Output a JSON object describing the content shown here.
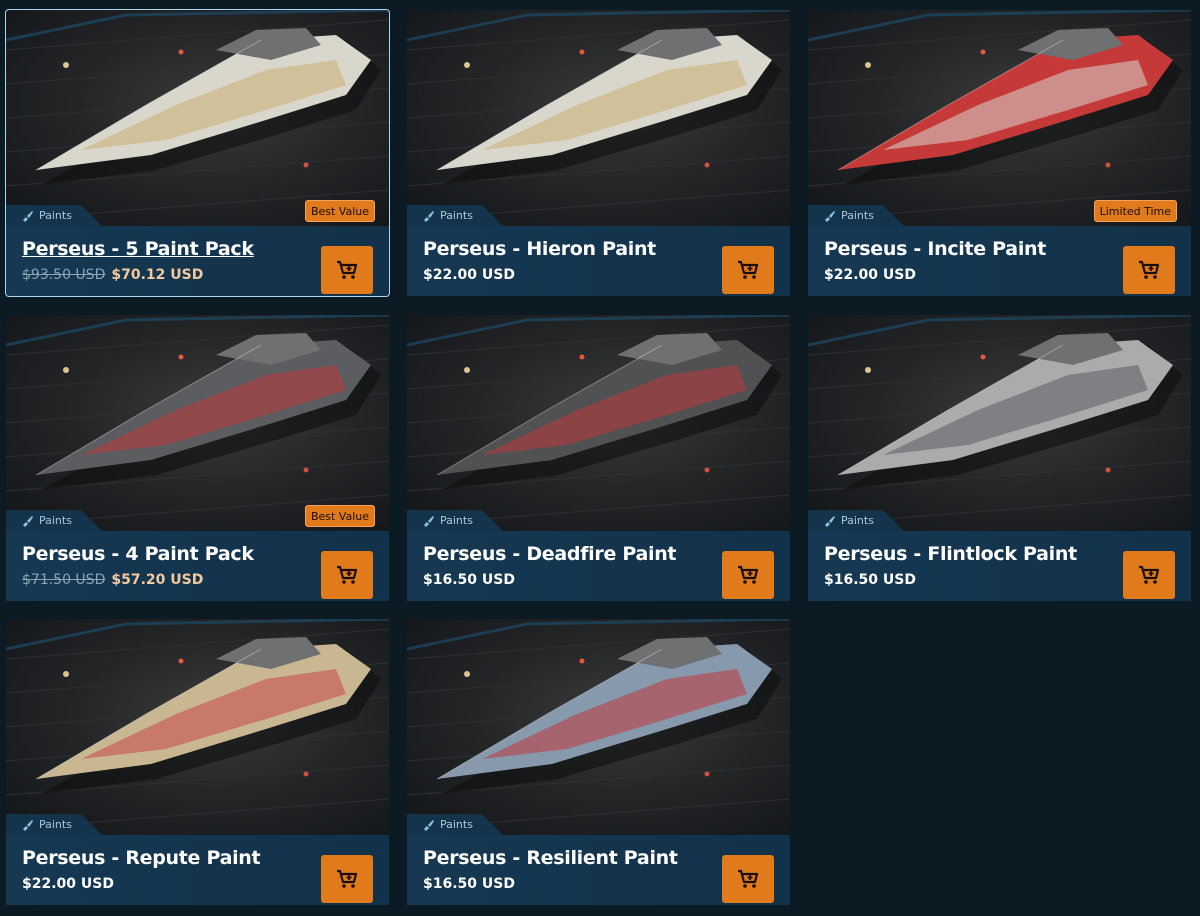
{
  "products": [
    {
      "category": "Paints",
      "title": "Perseus - 5 Paint Pack",
      "old_price": "$93.50 USD",
      "price": "$70.12 USD",
      "badge": "Best Value",
      "hull": "#d9d6cc",
      "accent": "#c9b071",
      "selected": true
    },
    {
      "category": "Paints",
      "title": "Perseus - Hieron Paint",
      "old_price": "",
      "price": "$22.00 USD",
      "badge": "",
      "hull": "#d9d6cc",
      "accent": "#c9b071"
    },
    {
      "category": "Paints",
      "title": "Perseus - Incite Paint",
      "old_price": "",
      "price": "$22.00 USD",
      "badge": "Limited Time",
      "hull": "#c53a38",
      "accent": "#d6d4d0"
    },
    {
      "category": "Paints",
      "title": "Perseus - 4 Paint Pack",
      "old_price": "$71.50 USD",
      "price": "$57.20 USD",
      "badge": "Best Value",
      "hull": "#5b5d60",
      "accent": "#c0383a"
    },
    {
      "category": "Paints",
      "title": "Perseus - Deadfire Paint",
      "old_price": "",
      "price": "$16.50 USD",
      "badge": "",
      "hull": "#4f5153",
      "accent": "#c0383a"
    },
    {
      "category": "Paints",
      "title": "Perseus - Flintlock Paint",
      "old_price": "",
      "price": "$16.50 USD",
      "badge": "",
      "hull": "#a9abad",
      "accent": "#5b5d60"
    },
    {
      "category": "Paints",
      "title": "Perseus - Repute Paint",
      "old_price": "",
      "price": "$22.00 USD",
      "badge": "",
      "hull": "#c8b791",
      "accent": "#c8474a"
    },
    {
      "category": "Paints",
      "title": "Perseus - Resilient Paint",
      "old_price": "",
      "price": "$16.50 USD",
      "badge": "",
      "hull": "#8799ad",
      "accent": "#c0383a"
    }
  ],
  "colors": {
    "background": "#0c1a24",
    "card": "#13344b",
    "button": "#e07a1a"
  }
}
